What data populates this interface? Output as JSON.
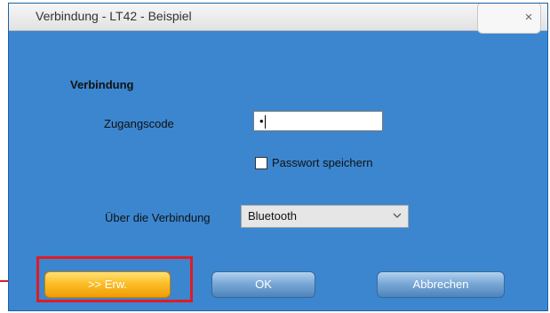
{
  "window": {
    "title": "Verbindung - LT42 - Beispiel",
    "close_label": "×"
  },
  "section": {
    "heading": "Verbindung"
  },
  "access_code": {
    "label": "Zugangscode",
    "value": "•"
  },
  "save_password": {
    "label": "Passwort speichern",
    "checked": false
  },
  "connection": {
    "label": "Über die Verbindung",
    "selected": "Bluetooth"
  },
  "buttons": {
    "extended": ">> Erw.",
    "ok": "OK",
    "cancel": "Abbrechen"
  },
  "colors": {
    "dialog_background": "#3b86cf",
    "highlight": "#e01b24",
    "extended_button": "#fbbe28",
    "standard_button": "#7aa8d6"
  },
  "icons": {
    "close": "close-icon",
    "dropdown": "chevron-down-icon",
    "pointer": "arrow-right-icon"
  }
}
